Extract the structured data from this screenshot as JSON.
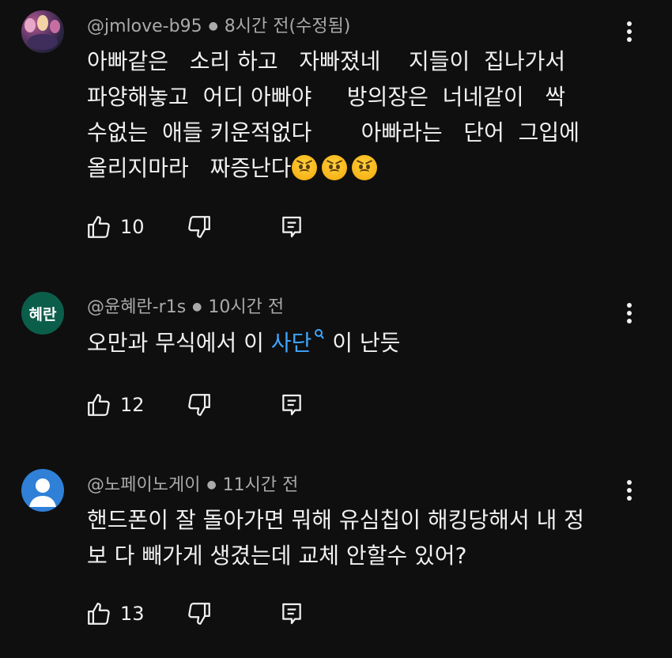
{
  "comments": [
    {
      "author": "@jmlove-b95",
      "time": "8시간 전(수정됨)",
      "avatar": {
        "type": "photo"
      },
      "lines": [
        "아빠같은   소리 하고   자빠졌네    지들이  집나가서",
        "파양해놓고  어디 아빠야     방의장은  너네같이   싹",
        "수없는  애들 키운적없다       아빠라는   단어  그입에",
        "올리지마라   짜증난다"
      ],
      "emojis": [
        "angry-face-emoji",
        "angry-face-emoji",
        "angry-face-emoji"
      ],
      "likes": "10"
    },
    {
      "author": "@윤혜란-r1s",
      "time": "10시간 전",
      "avatar": {
        "type": "initials",
        "text": "혜란",
        "color": "#0b5e4a"
      },
      "text_before": "오만과 무식에서 이 ",
      "link_text": "사단",
      "text_after": " 이 난듯",
      "likes": "12"
    },
    {
      "author": "@노페이노게이",
      "time": "11시간 전",
      "avatar": {
        "type": "default",
        "color": "#2f80d6"
      },
      "lines": [
        "핸드폰이 잘 돌아가면 뭐해 유심칩이 해킹당해서 내 정",
        "보 다 빼가게 생겼는데 교체 안할수 있어?"
      ],
      "likes": "13"
    }
  ],
  "icons": {
    "like": "thumbs-up-icon",
    "dislike": "thumbs-down-icon",
    "reply": "reply-comment-icon",
    "more": "more-vertical-icon",
    "search_hint": "search-icon"
  },
  "colors": {
    "background": "#0f0f0f",
    "text": "#f1f1f1",
    "meta": "#aaaaaa",
    "link": "#3ea6ff"
  }
}
